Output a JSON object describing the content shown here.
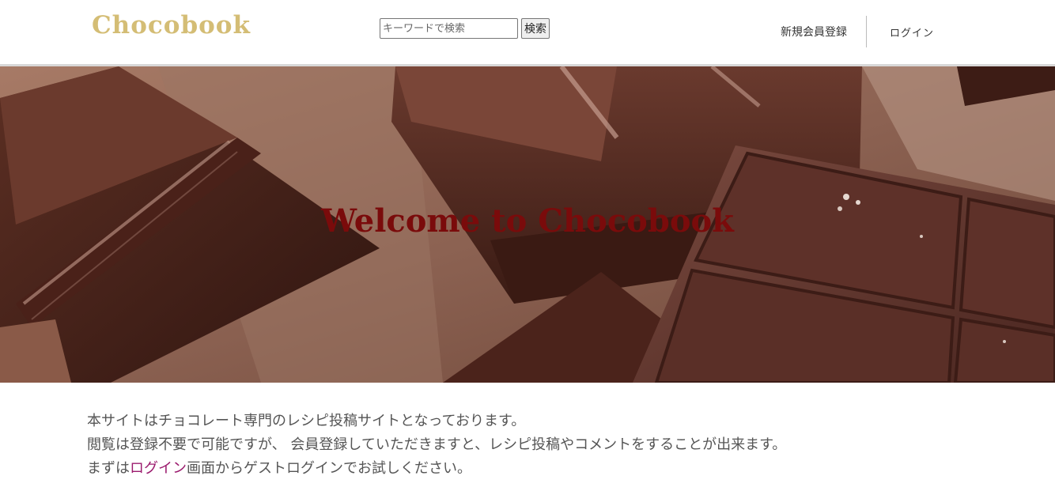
{
  "header": {
    "logo": "Chocobook",
    "search": {
      "placeholder": "キーワードで検索",
      "button": "検索"
    },
    "nav": {
      "signup": "新規会員登録",
      "login": "ログイン"
    }
  },
  "hero": {
    "title": "Welcome to Chocobook",
    "image": "chocolate-bars-photo"
  },
  "intro": {
    "line1": "本サイトはチョコレート専門のレシピ投稿サイトとなっております。",
    "line2": "閲覧は登録不要で可能ですが、 会員登録していただきますと、レシピ投稿やコメントをすることが出来ます。",
    "line3_prefix": "まずは",
    "line3_link": "ログイン",
    "line3_suffix": "画面からゲストログインでお試しください。"
  },
  "colors": {
    "logo": "#d4bd75",
    "hero_title": "#7a0b0b",
    "link": "#9b1b6e"
  }
}
